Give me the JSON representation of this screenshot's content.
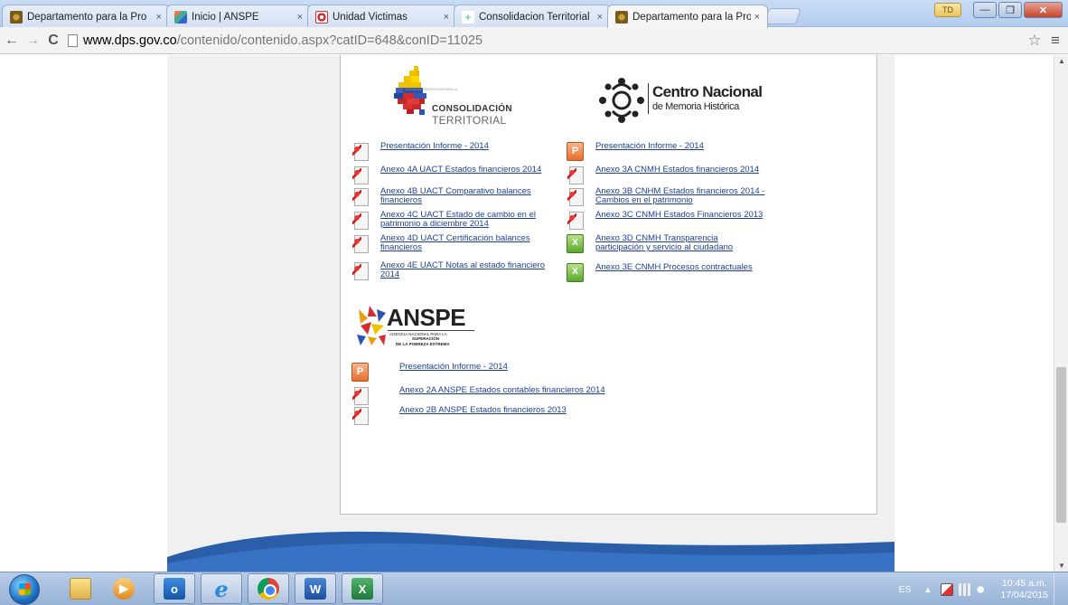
{
  "browser": {
    "tabs": [
      {
        "label": "Departamento para la Pro",
        "active": false
      },
      {
        "label": "Inicio | ANSPE",
        "active": false
      },
      {
        "label": "Unidad Victimas",
        "active": false
      },
      {
        "label": "Consolidacion Territorial",
        "active": false
      },
      {
        "label": "Departamento para la Pro",
        "active": true
      }
    ],
    "close_glyph": "×",
    "user_badge": "TD",
    "url_host": "www.dps.gov.co",
    "url_path": "/contenido/contenido.aspx?catID=648&conID=11025"
  },
  "logos": {
    "consolidacion": {
      "tagline": "UNIDAD ADMINISTRATIVA PARA LA",
      "word1": "CONSOLIDACIÓN",
      "word2": "TERRITORIAL"
    },
    "cnmh": {
      "line1": "Centro Nacional",
      "line2": "de Memoria Histórica"
    },
    "anspe": {
      "word": "ANSPE",
      "sub1": "AGENCIA NACIONAL PARA LA",
      "sub2": "SUPERACIÓN",
      "sub3": "DE LA POBREZA EXTREMA"
    }
  },
  "uact_docs": [
    {
      "icon": "pdf-icon",
      "lines": [
        "Presentación Informe - 2014"
      ]
    },
    {
      "icon": "pdf-icon",
      "lines": [
        "Anexo 4A UACT Estados financieros 2014"
      ]
    },
    {
      "icon": "pdf-icon",
      "lines": [
        "Anexo 4B UACT Comparativo balances",
        "financieros"
      ]
    },
    {
      "icon": "pdf-icon",
      "lines": [
        "Anexo 4C UACT Estado de cambio en el",
        "patrimonio a diciembre 2014"
      ]
    },
    {
      "icon": "pdf-icon",
      "lines": [
        "Anexo 4D UACT Certificación balances",
        "financieros"
      ]
    },
    {
      "icon": "pdf-icon",
      "lines": [
        "Anexo 4E UACT Notas al estado financiero",
        "2014"
      ]
    }
  ],
  "cnmh_docs": [
    {
      "icon": "ppt-icon",
      "lines": [
        "Presentación Informe - 2014"
      ]
    },
    {
      "icon": "pdf-icon",
      "lines": [
        "Anexo 3A CNMH Estados financieros 2014"
      ]
    },
    {
      "icon": "pdf-icon",
      "lines": [
        "Anexo 3B CNHM Estados financieros 2014 -",
        "Cambios en el patrimonio"
      ]
    },
    {
      "icon": "pdf-icon",
      "lines": [
        "Anexo 3C CNMH Estados Financieros 2013"
      ]
    },
    {
      "icon": "xls-icon",
      "lines": [
        "Anexo 3D CNMH Transparencia",
        "participación y servicio al ciudadano"
      ]
    },
    {
      "icon": "xls-icon",
      "lines": [
        "Anexo 3E CNMH Procesos contractuales"
      ]
    }
  ],
  "anspe_docs": [
    {
      "icon": "ppt-icon",
      "lines": [
        "Presentación Informe - 2014"
      ]
    },
    {
      "icon": "pdf-icon",
      "lines": [
        "Anexo 2A ANSPE Estados contables financieros 2014"
      ]
    },
    {
      "icon": "pdf-icon",
      "lines": [
        "Anexo 2B ANSPE Estados financieros 2013"
      ]
    }
  ],
  "taskbar": {
    "apps": [
      "explorer-icon",
      "media-player-icon",
      "outlook-icon",
      "internet-explorer-icon",
      "chrome-icon",
      "word-icon",
      "excel-icon"
    ],
    "app_glyphs": {
      "outlook": "o",
      "ie": "e",
      "word": "W",
      "excel": "X"
    },
    "lang": "ES",
    "tray_arrow": "▲",
    "time": "10:45 a.m.",
    "date": "17/04/2015"
  },
  "colors": {
    "link": "#1f3f8f",
    "wave_blue": "#2b5ea8"
  }
}
